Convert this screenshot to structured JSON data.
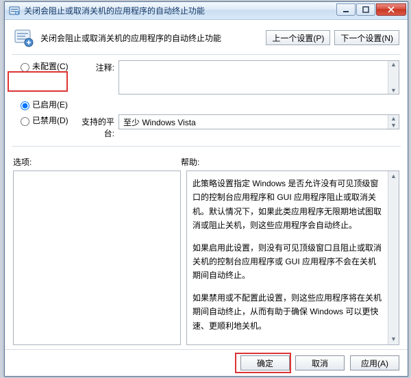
{
  "titlebar": {
    "title": "关闭会阻止或取消关机的应用程序的自动终止功能"
  },
  "header": {
    "subtitle": "关闭会阻止或取消关机的应用程序的自动终止功能",
    "prev": "上一个设置(P)",
    "next": "下一个设置(N)"
  },
  "radios": {
    "notConfigured": "未配置(C)",
    "enabled": "已启用(E)",
    "disabled": "已禁用(D)",
    "selected": "enabled"
  },
  "labels": {
    "comment": "注释:",
    "platform": "支持的平台:",
    "options": "选项:",
    "help": "帮助:"
  },
  "fields": {
    "comment_value": "",
    "platform_value": "至少 Windows Vista"
  },
  "help": {
    "p1": "此策略设置指定 Windows 是否允许没有可见顶级窗口的控制台应用程序和 GUI 应用程序阻止或取消关机。默认情况下，如果此类应用程序无限期地试图取消或阻止关机，则这些应用程序会自动终止。",
    "p2": "如果启用此设置，则没有可见顶级窗口且阻止或取消关机的控制台应用程序或 GUI 应用程序不会在关机期间自动终止。",
    "p3": "如果禁用或不配置此设置，则这些应用程序将在关机期间自动终止，从而有助于确保 Windows 可以更快速、更顺利地关机。"
  },
  "footer": {
    "ok": "确定",
    "cancel": "取消",
    "apply": "应用(A)"
  }
}
